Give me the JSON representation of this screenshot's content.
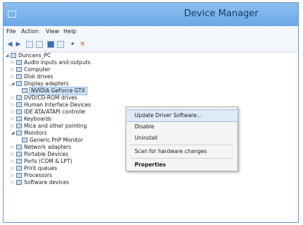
{
  "window": {
    "title": "Device Manager"
  },
  "menu": [
    "File",
    "Action",
    "View",
    "Help"
  ],
  "toolbar": {
    "icons": [
      "back-arrow-icon",
      "forward-arrow-icon",
      "properties-icon",
      "help-icon",
      "scan-hardware-icon",
      "update-driver-icon",
      "uninstall-icon",
      "disable-icon"
    ]
  },
  "tree": {
    "root": "Duncans_PC",
    "items": [
      "Audio inputs and outputs",
      "Computer",
      "Disk drives",
      "Display adapters",
      "NVIDIA GeForce GTX",
      "DVD/CD-ROM drives",
      "Human Interface Devices",
      "IDE ATA/ATAPI controlle",
      "Keyboards",
      "Mice and other pointing",
      "Monitors",
      "Generic PnP Monitor",
      "Network adapters",
      "Portable Devices",
      "Ports (COM & LPT)",
      "Print queues",
      "Processors",
      "Software devices"
    ]
  },
  "context_menu": {
    "items": [
      "Update Driver Software...",
      "Disable",
      "Uninstall",
      "Scan for hardware changes",
      "Properties"
    ]
  },
  "colors": {
    "titlebar": "#7fb4ee",
    "highlight": "#dfeaf7",
    "selection": "#cde3fb"
  }
}
